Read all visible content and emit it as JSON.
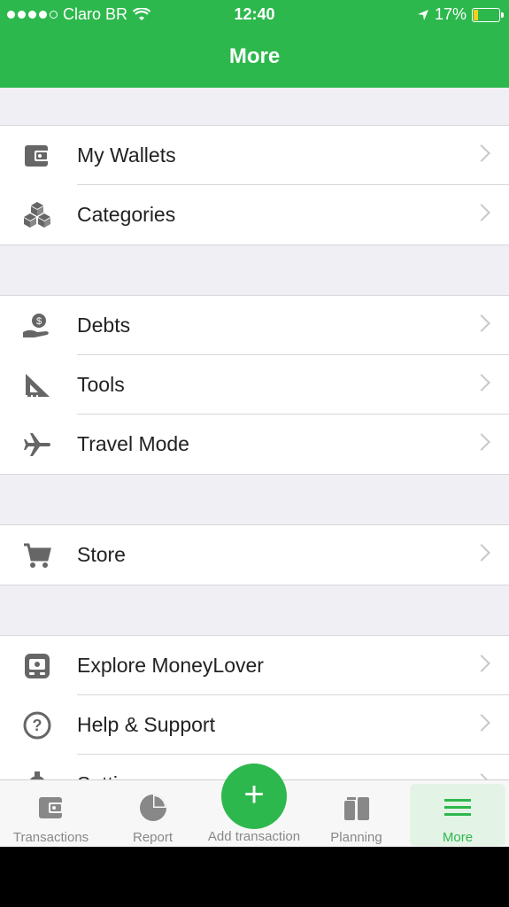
{
  "statusbar": {
    "carrier": "Claro BR",
    "time": "12:40",
    "battery": "17%"
  },
  "header": {
    "title": "More"
  },
  "groups": [
    {
      "items": [
        {
          "label": "My Wallets"
        },
        {
          "label": "Categories"
        }
      ]
    },
    {
      "items": [
        {
          "label": "Debts"
        },
        {
          "label": "Tools"
        },
        {
          "label": "Travel Mode"
        }
      ]
    },
    {
      "items": [
        {
          "label": "Store"
        }
      ]
    },
    {
      "items": [
        {
          "label": "Explore MoneyLover"
        },
        {
          "label": "Help & Support"
        },
        {
          "label": "Settings"
        }
      ]
    }
  ],
  "tabbar": {
    "tabs": [
      {
        "label": "Transactions",
        "icon": "wallet-icon"
      },
      {
        "label": "Report",
        "icon": "pie-chart-icon"
      },
      {
        "label": "Add transaction",
        "icon": "plus-icon"
      },
      {
        "label": "Planning",
        "icon": "planning-icon"
      },
      {
        "label": "More",
        "icon": "menu-icon"
      }
    ],
    "active": "More"
  },
  "colors": {
    "brand": "#2db84d",
    "active_tab_bg": "#e3f4e6"
  }
}
